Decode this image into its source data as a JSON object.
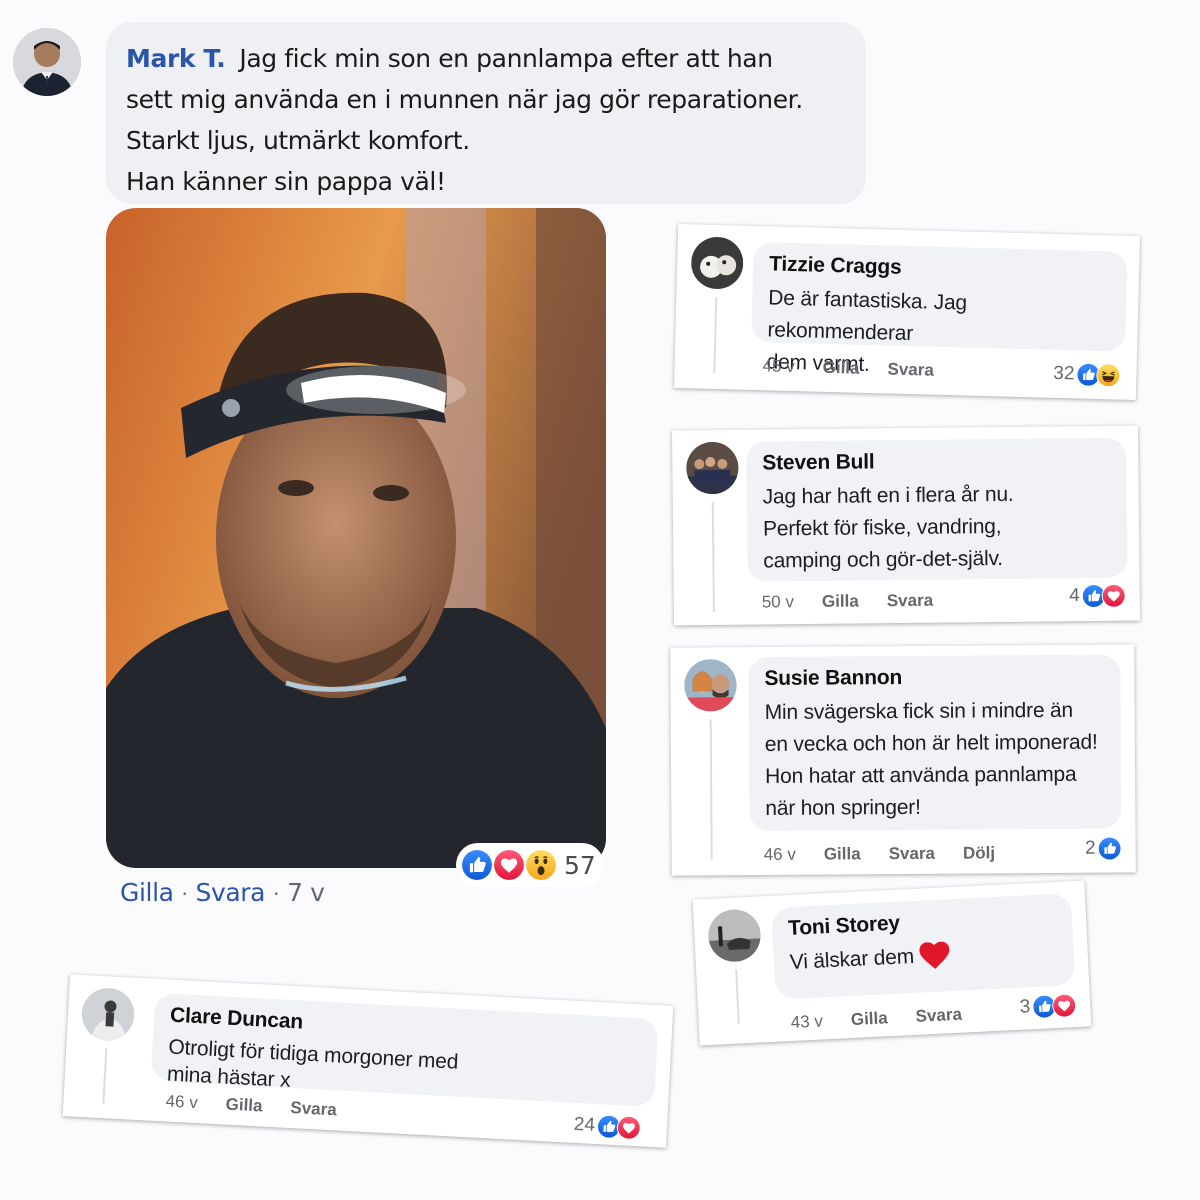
{
  "post": {
    "author": "Mark T.",
    "lines": [
      "Jag fick min son en pannlampa efter att han",
      "sett mig använda en i munnen när jag gör reparationer.",
      "Starkt ljus, utmärkt komfort.",
      "Han känner sin pappa väl!"
    ],
    "like_label": "Gilla",
    "reply_label": "Svara",
    "time": "7 v",
    "reaction_count": "57",
    "reactions": [
      "like-icon",
      "love-icon",
      "wow-icon"
    ]
  },
  "comments": [
    {
      "name": "Tizzie Craggs",
      "lines": [
        "De är fantastiska.  Jag rekommenderar",
        "dem varmt."
      ],
      "time": "45 v",
      "like": "Gilla",
      "reply": "Svara",
      "count": "32",
      "reactions": [
        "like-icon",
        "haha-icon"
      ]
    },
    {
      "name": "Steven Bull",
      "lines": [
        "Jag har haft en i flera år nu.",
        "Perfekt för fiske, vandring,",
        "camping och gör-det-själv."
      ],
      "time": "50 v",
      "like": "Gilla",
      "reply": "Svara",
      "count": "4",
      "reactions": [
        "like-icon",
        "love-icon"
      ]
    },
    {
      "name": "Susie Bannon",
      "lines": [
        "Min svägerska fick sin i mindre än",
        "en vecka och hon är helt imponerad!",
        "Hon hatar att använda pannlampa",
        "när hon springer!"
      ],
      "time": "46 v",
      "like": "Gilla",
      "reply": "Svara",
      "hide": "Dölj",
      "count": "2",
      "reactions": [
        "like-icon"
      ]
    },
    {
      "name": "Toni Storey",
      "lines": [
        "Vi älskar dem"
      ],
      "time": "43 v",
      "like": "Gilla",
      "reply": "Svara",
      "count": "3",
      "reactions": [
        "like-icon",
        "love-icon"
      ]
    },
    {
      "name": "Clare Duncan",
      "lines": [
        "Otroligt för tidiga morgoner med",
        "mina hästar x"
      ],
      "time": "46 v",
      "like": "Gilla",
      "reply": "Svara",
      "count": "24",
      "reactions": [
        "like-icon",
        "love-icon"
      ]
    }
  ],
  "colors": {
    "link_blue": "#2b55a8",
    "like_blue": "#1877f2",
    "love_red": "#f02849",
    "bubble_grey": "#f0f2f5"
  }
}
